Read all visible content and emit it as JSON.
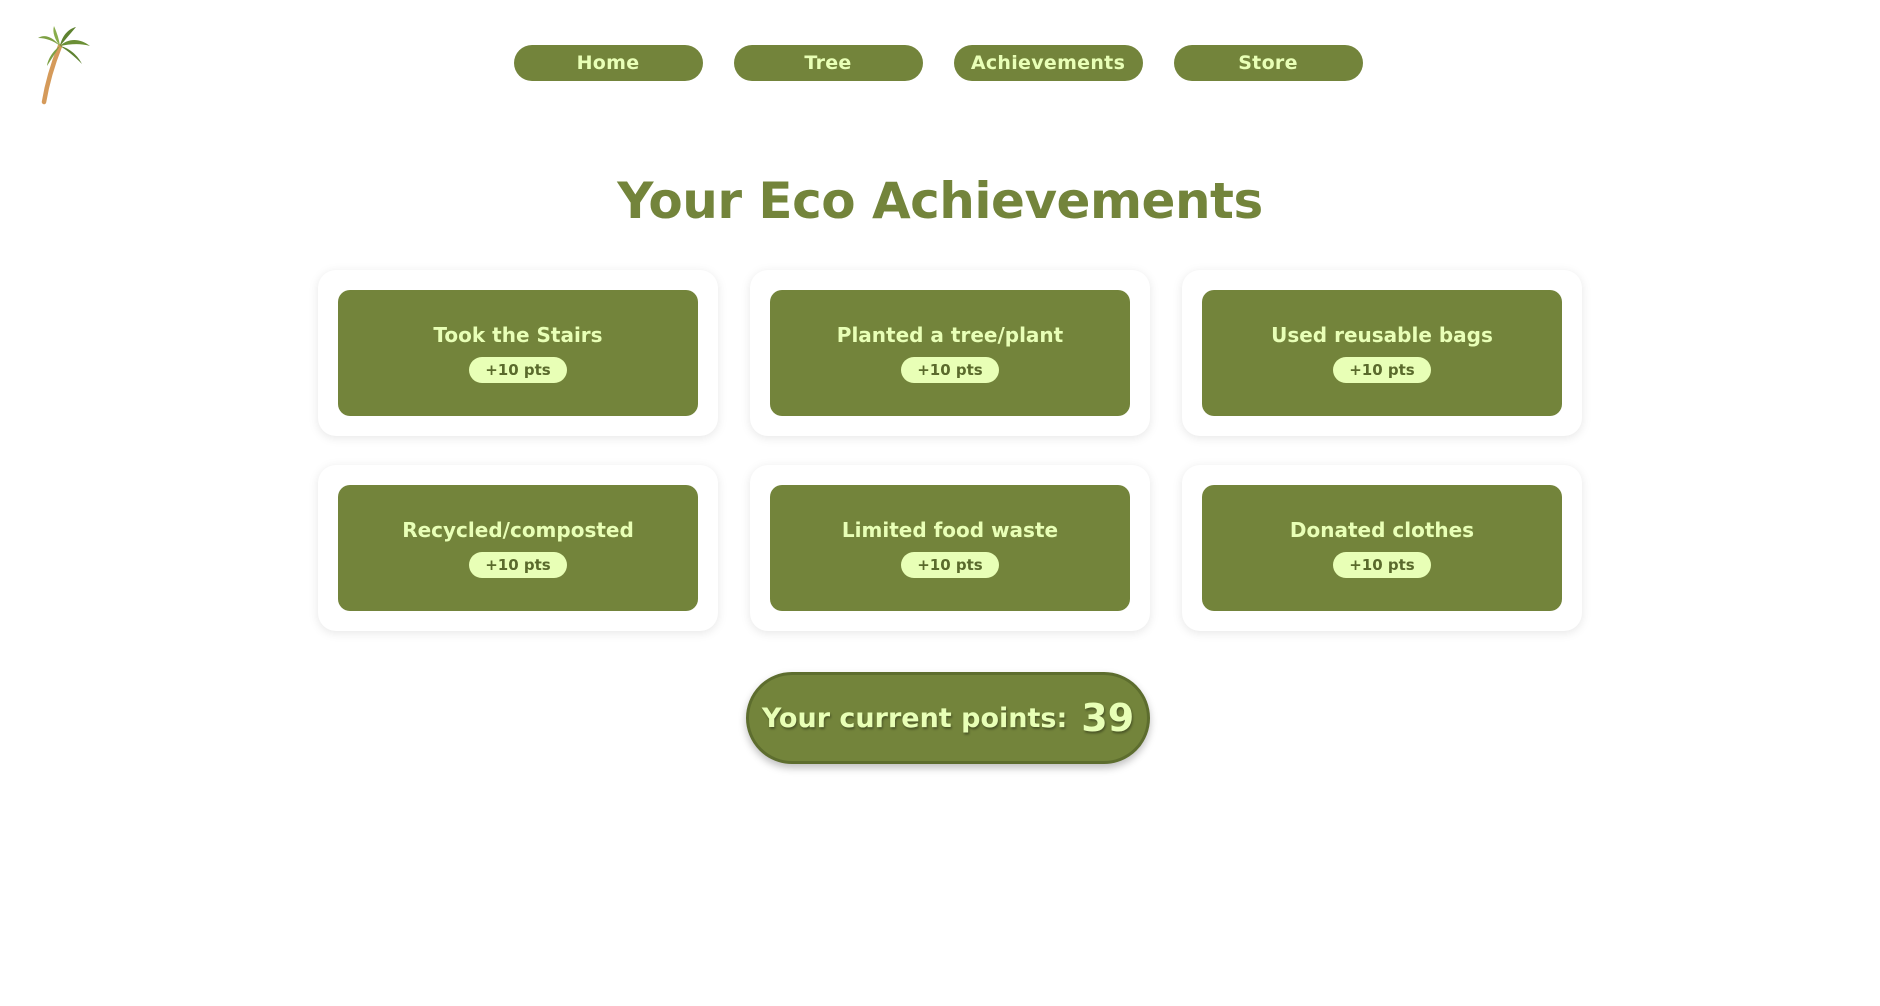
{
  "logo": {
    "icon": "palm-tree-icon"
  },
  "nav": {
    "items": [
      {
        "label": "Home"
      },
      {
        "label": "Tree"
      },
      {
        "label": "Achievements"
      },
      {
        "label": "Store"
      }
    ]
  },
  "page": {
    "title": "Your Eco Achievements"
  },
  "achievements": [
    {
      "title": "Took the Stairs",
      "points": "+10 pts"
    },
    {
      "title": "Planted a tree/plant",
      "points": "+10 pts"
    },
    {
      "title": "Used reusable bags",
      "points": "+10 pts"
    },
    {
      "title": "Recycled/composted",
      "points": "+10 pts"
    },
    {
      "title": "Limited food waste",
      "points": "+10 pts"
    },
    {
      "title": "Donated clothes",
      "points": "+10 pts"
    }
  ],
  "points": {
    "label": "Your current points:",
    "value": "39"
  },
  "colors": {
    "primary": "#73843b",
    "accent_text": "#e8ffb6",
    "badge_text": "#5a6a2c"
  }
}
